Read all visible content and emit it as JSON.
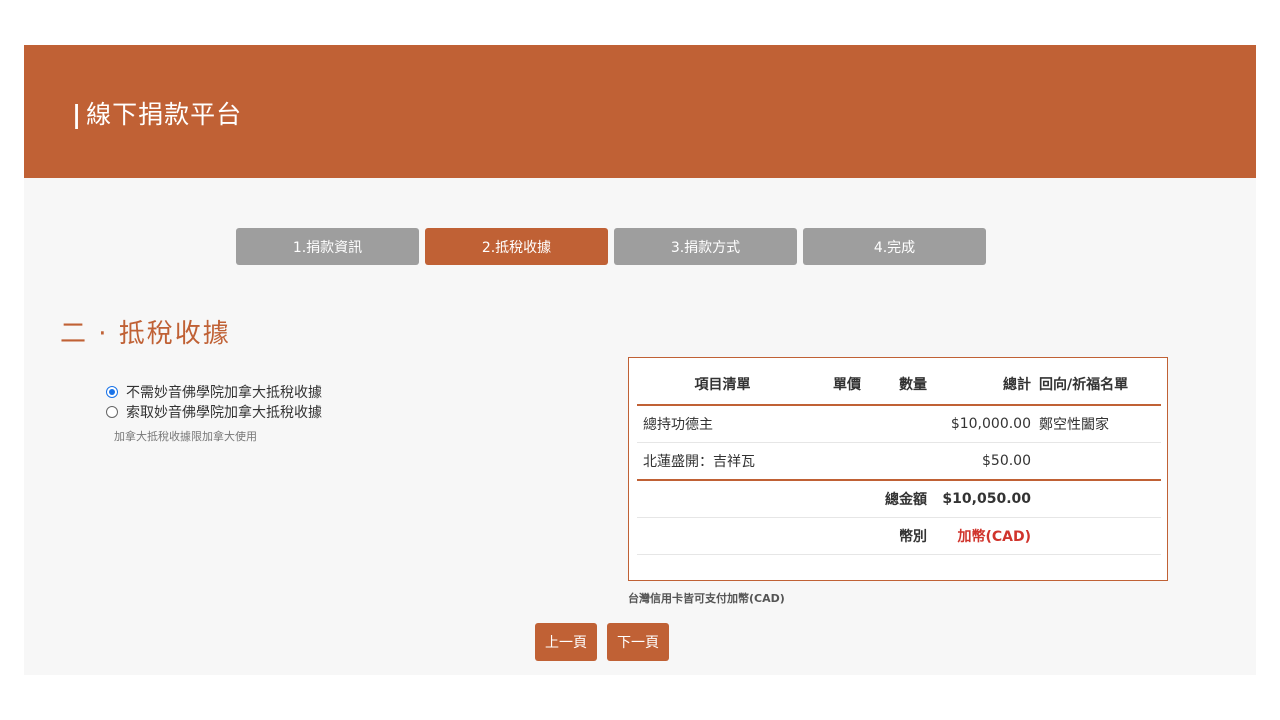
{
  "header": {
    "bar": "|",
    "title": "線下捐款平台"
  },
  "steps": [
    {
      "label": "1.捐款資訊",
      "active": false
    },
    {
      "label": "2.抵稅收據",
      "active": true
    },
    {
      "label": "3.捐款方式",
      "active": false
    },
    {
      "label": "4.完成",
      "active": false
    }
  ],
  "section": {
    "title": "二 · 抵稅收據"
  },
  "receipt_options": [
    {
      "label": "不需妙音佛學院加拿大抵稅收據",
      "checked": true
    },
    {
      "label": "索取妙音佛學院加拿大抵稅收據",
      "checked": false
    }
  ],
  "receipt_note": "加拿大抵稅收據限加拿大使用",
  "table": {
    "headers": [
      "項目清單",
      "單價",
      "數量",
      "總計",
      "回向/祈福名單"
    ],
    "rows": [
      {
        "item": "總持功德主",
        "price": "",
        "qty": "",
        "total": "$10,000.00",
        "dedication": "鄭空性闔家"
      },
      {
        "item": "北蓮盛開：吉祥瓦",
        "price": "",
        "qty": "",
        "total": "$50.00",
        "dedication": ""
      }
    ],
    "sum_label": "總金額",
    "sum_value": "$10,050.00",
    "currency_label": "幣別",
    "currency_value": "加幣(CAD)"
  },
  "table_note": "台灣信用卡皆可支付加幣(CAD)",
  "buttons": {
    "prev": "上一頁",
    "next": "下一頁"
  },
  "colors": {
    "accent": "#c06135",
    "inactive_step": "#9e9e9e",
    "currency_red": "#d0342c"
  }
}
